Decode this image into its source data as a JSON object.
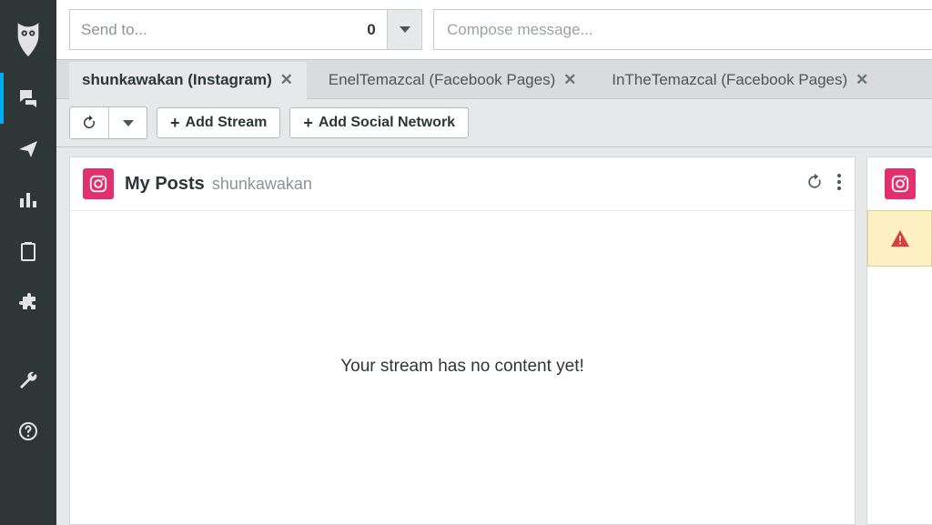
{
  "compose": {
    "sendto_placeholder": "Send to...",
    "count": "0",
    "message_placeholder": "Compose message..."
  },
  "tabs": [
    {
      "label": "shunkawakan (Instagram)",
      "active": true
    },
    {
      "label": "EnelTemazcal (Facebook Pages)",
      "active": false
    },
    {
      "label": "InTheTemazcal (Facebook Pages)",
      "active": false
    }
  ],
  "toolbar": {
    "add_stream": "Add Stream",
    "add_network": "Add Social Network"
  },
  "stream": {
    "title": "My Posts",
    "subtitle": "shunkawakan",
    "empty_message": "Your stream has no content yet!"
  },
  "colors": {
    "instagram": "#e1306c",
    "warning": "#d93f3f"
  }
}
